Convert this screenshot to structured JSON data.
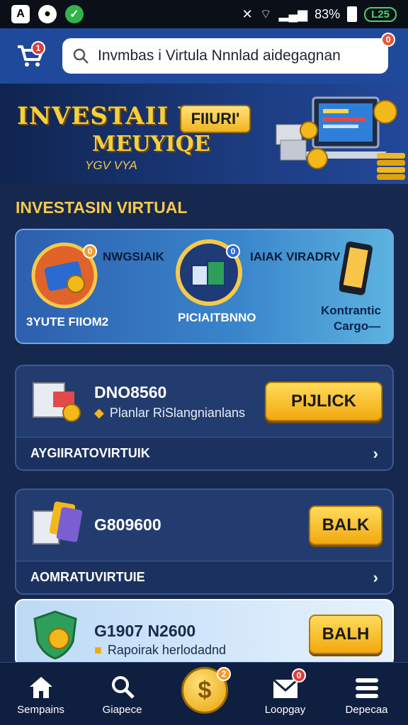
{
  "status_bar": {
    "battery_percent": "83%",
    "battery_pill": "L25"
  },
  "header": {
    "cart_badge": "1",
    "search_text": "Invmbas i Virtula Nnnlad aidegagnan",
    "notification_badge": "0"
  },
  "banner": {
    "title_line1": "INVESTAII VR",
    "title_line2": "MEUYIQE",
    "subtitle": "YGV VYA",
    "button_label": "FIIURI'"
  },
  "section_title": "INVESTASIN VIRTUAL",
  "feature_card": {
    "item1_title": "NWGSIAIK",
    "item1_caption": "3YUTE FIIOM2",
    "item1_badge": "0",
    "item2_caption": "PICIAITBNNO",
    "item2_badge": "0",
    "item3_title": "IAIAK VIRADRV",
    "item3_caption_line1": "Kontrantic",
    "item3_caption_line2": "Cargo—"
  },
  "offers": [
    {
      "title": "DNO8560",
      "subtitle": "Planlar RiSlangnianlans",
      "button": "PIJLICK",
      "footer": "AYGIIRATOVIRTUIK"
    },
    {
      "title": "G809600",
      "subtitle": "",
      "button": "BALK",
      "footer": "AOMRATUVIRTUIE"
    },
    {
      "title": "G1907 N2600",
      "subtitle": "Rapoirak herlodadnd",
      "button": "BALH",
      "footer": ""
    }
  ],
  "nav": {
    "items": [
      {
        "label": "Sempains",
        "icon": "home-icon"
      },
      {
        "label": "Giapece",
        "icon": "search-icon"
      },
      {
        "label": "Loopgay",
        "icon": "mail-icon"
      },
      {
        "label": "Depecaa",
        "icon": "menu-icon"
      }
    ],
    "center_badge": "2",
    "mail_badge": "0",
    "center_symbol": "$"
  },
  "colors": {
    "brand_gold": "#f5c94b",
    "header_blue": "#1f4a9c",
    "background": "#16284d"
  }
}
